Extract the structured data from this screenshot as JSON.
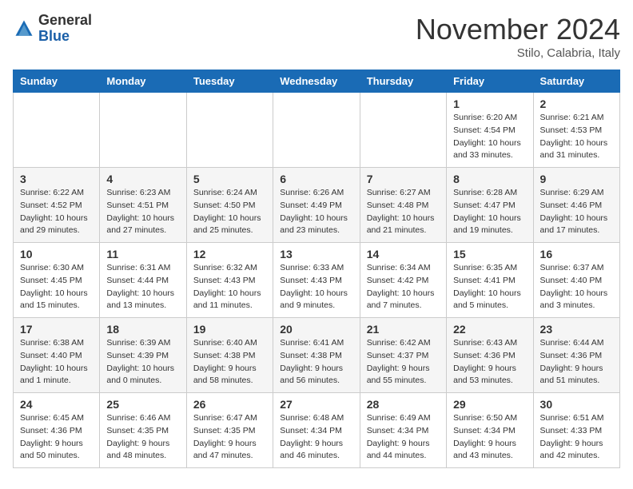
{
  "header": {
    "logo_general": "General",
    "logo_blue": "Blue",
    "month": "November 2024",
    "location": "Stilo, Calabria, Italy"
  },
  "days_of_week": [
    "Sunday",
    "Monday",
    "Tuesday",
    "Wednesday",
    "Thursday",
    "Friday",
    "Saturday"
  ],
  "weeks": [
    [
      {
        "date": "",
        "info": ""
      },
      {
        "date": "",
        "info": ""
      },
      {
        "date": "",
        "info": ""
      },
      {
        "date": "",
        "info": ""
      },
      {
        "date": "",
        "info": ""
      },
      {
        "date": "1",
        "info": "Sunrise: 6:20 AM\nSunset: 4:54 PM\nDaylight: 10 hours\nand 33 minutes."
      },
      {
        "date": "2",
        "info": "Sunrise: 6:21 AM\nSunset: 4:53 PM\nDaylight: 10 hours\nand 31 minutes."
      }
    ],
    [
      {
        "date": "3",
        "info": "Sunrise: 6:22 AM\nSunset: 4:52 PM\nDaylight: 10 hours\nand 29 minutes."
      },
      {
        "date": "4",
        "info": "Sunrise: 6:23 AM\nSunset: 4:51 PM\nDaylight: 10 hours\nand 27 minutes."
      },
      {
        "date": "5",
        "info": "Sunrise: 6:24 AM\nSunset: 4:50 PM\nDaylight: 10 hours\nand 25 minutes."
      },
      {
        "date": "6",
        "info": "Sunrise: 6:26 AM\nSunset: 4:49 PM\nDaylight: 10 hours\nand 23 minutes."
      },
      {
        "date": "7",
        "info": "Sunrise: 6:27 AM\nSunset: 4:48 PM\nDaylight: 10 hours\nand 21 minutes."
      },
      {
        "date": "8",
        "info": "Sunrise: 6:28 AM\nSunset: 4:47 PM\nDaylight: 10 hours\nand 19 minutes."
      },
      {
        "date": "9",
        "info": "Sunrise: 6:29 AM\nSunset: 4:46 PM\nDaylight: 10 hours\nand 17 minutes."
      }
    ],
    [
      {
        "date": "10",
        "info": "Sunrise: 6:30 AM\nSunset: 4:45 PM\nDaylight: 10 hours\nand 15 minutes."
      },
      {
        "date": "11",
        "info": "Sunrise: 6:31 AM\nSunset: 4:44 PM\nDaylight: 10 hours\nand 13 minutes."
      },
      {
        "date": "12",
        "info": "Sunrise: 6:32 AM\nSunset: 4:43 PM\nDaylight: 10 hours\nand 11 minutes."
      },
      {
        "date": "13",
        "info": "Sunrise: 6:33 AM\nSunset: 4:43 PM\nDaylight: 10 hours\nand 9 minutes."
      },
      {
        "date": "14",
        "info": "Sunrise: 6:34 AM\nSunset: 4:42 PM\nDaylight: 10 hours\nand 7 minutes."
      },
      {
        "date": "15",
        "info": "Sunrise: 6:35 AM\nSunset: 4:41 PM\nDaylight: 10 hours\nand 5 minutes."
      },
      {
        "date": "16",
        "info": "Sunrise: 6:37 AM\nSunset: 4:40 PM\nDaylight: 10 hours\nand 3 minutes."
      }
    ],
    [
      {
        "date": "17",
        "info": "Sunrise: 6:38 AM\nSunset: 4:40 PM\nDaylight: 10 hours\nand 1 minute."
      },
      {
        "date": "18",
        "info": "Sunrise: 6:39 AM\nSunset: 4:39 PM\nDaylight: 10 hours\nand 0 minutes."
      },
      {
        "date": "19",
        "info": "Sunrise: 6:40 AM\nSunset: 4:38 PM\nDaylight: 9 hours\nand 58 minutes."
      },
      {
        "date": "20",
        "info": "Sunrise: 6:41 AM\nSunset: 4:38 PM\nDaylight: 9 hours\nand 56 minutes."
      },
      {
        "date": "21",
        "info": "Sunrise: 6:42 AM\nSunset: 4:37 PM\nDaylight: 9 hours\nand 55 minutes."
      },
      {
        "date": "22",
        "info": "Sunrise: 6:43 AM\nSunset: 4:36 PM\nDaylight: 9 hours\nand 53 minutes."
      },
      {
        "date": "23",
        "info": "Sunrise: 6:44 AM\nSunset: 4:36 PM\nDaylight: 9 hours\nand 51 minutes."
      }
    ],
    [
      {
        "date": "24",
        "info": "Sunrise: 6:45 AM\nSunset: 4:36 PM\nDaylight: 9 hours\nand 50 minutes."
      },
      {
        "date": "25",
        "info": "Sunrise: 6:46 AM\nSunset: 4:35 PM\nDaylight: 9 hours\nand 48 minutes."
      },
      {
        "date": "26",
        "info": "Sunrise: 6:47 AM\nSunset: 4:35 PM\nDaylight: 9 hours\nand 47 minutes."
      },
      {
        "date": "27",
        "info": "Sunrise: 6:48 AM\nSunset: 4:34 PM\nDaylight: 9 hours\nand 46 minutes."
      },
      {
        "date": "28",
        "info": "Sunrise: 6:49 AM\nSunset: 4:34 PM\nDaylight: 9 hours\nand 44 minutes."
      },
      {
        "date": "29",
        "info": "Sunrise: 6:50 AM\nSunset: 4:34 PM\nDaylight: 9 hours\nand 43 minutes."
      },
      {
        "date": "30",
        "info": "Sunrise: 6:51 AM\nSunset: 4:33 PM\nDaylight: 9 hours\nand 42 minutes."
      }
    ]
  ]
}
